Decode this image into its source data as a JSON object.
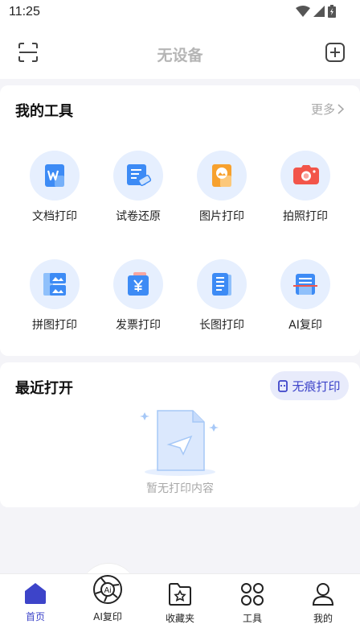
{
  "status_bar": {
    "time": "11:25"
  },
  "header": {
    "title": "无设备"
  },
  "tools": {
    "title": "我的工具",
    "more_label": "更多",
    "items": [
      {
        "label": "文档打印",
        "icon": "word-doc-icon"
      },
      {
        "label": "试卷还原",
        "icon": "exam-erase-icon"
      },
      {
        "label": "图片打印",
        "icon": "image-icon"
      },
      {
        "label": "拍照打印",
        "icon": "camera-icon"
      },
      {
        "label": "拼图打印",
        "icon": "collage-icon"
      },
      {
        "label": "发票打印",
        "icon": "invoice-icon"
      },
      {
        "label": "长图打印",
        "icon": "long-image-icon"
      },
      {
        "label": "AI复印",
        "icon": "ai-copy-icon"
      }
    ]
  },
  "recent": {
    "title": "最近打开",
    "incognito_label": "无痕打印",
    "empty_text": "暂无打印内容"
  },
  "bottom_nav": {
    "items": [
      {
        "label": "首页",
        "icon": "home-icon",
        "active": true
      },
      {
        "label": "AI复印",
        "icon": "ai-aperture-icon"
      },
      {
        "label": "收藏夹",
        "icon": "favorites-folder-icon"
      },
      {
        "label": "工具",
        "icon": "grid-tools-icon"
      },
      {
        "label": "我的",
        "icon": "profile-icon"
      }
    ]
  },
  "colors": {
    "accent": "#3d44c9",
    "tool_bg": "#e6effe",
    "primary_blue": "#3d8bf5"
  }
}
